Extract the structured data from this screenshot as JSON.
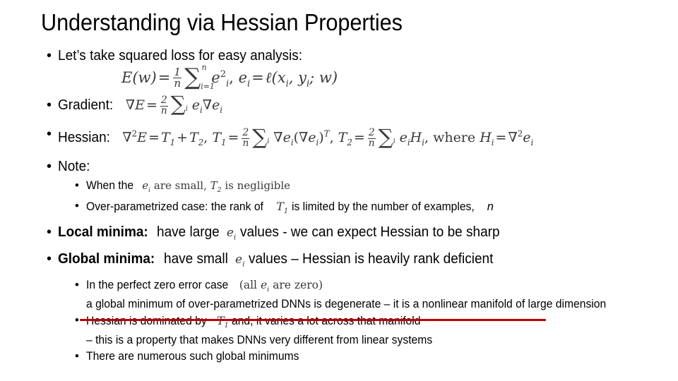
{
  "slide": {
    "title": "Understanding via Hessian Properties",
    "background_color": "#FFFFFF",
    "text_color": "#000000",
    "highlight_color": "#C00000"
  },
  "bullets": {
    "squared_loss_intro": "Let’s take squared loss for easy analysis:",
    "gradient_label": "Gradient:",
    "hessian_label": "Hessian:",
    "note_label": "Note:",
    "note_when_prefix": "When the",
    "over_parametrized_a": "Over-parametrized case: the rank of",
    "over_parametrized_b": "is limited by the number of examples,",
    "over_parametrized_n": "n",
    "local_minima_label": "Local minima:",
    "local_minima_a": "have large",
    "local_minima_b": "values - we can expect Hessian to be sharp",
    "global_minima_label": "Global minima:",
    "global_minima_a": "have small",
    "global_minima_b": "values – Hessian is heavily rank deficient",
    "zero_error_a": "In the perfect zero error case",
    "zero_error_b": "a global minimum of over-parametrized DNNs is degenerate – it is a nonlinear manifold of large dimension",
    "dominated_a": "Hessian is dominated by",
    "dominated_b": "and, it varies a lot across that manifold",
    "dominated_c": "– this is a property that makes DNNs very different from linear systems",
    "numerous_minimums": "There are numerous such global minimums"
  },
  "math": {
    "loss_E": "E",
    "loss_w": "(w)",
    "equals": "=",
    "one": "1",
    "two": "2",
    "n": "n",
    "sum_lower_i1": "i=1",
    "sum_upper_n": "n",
    "sum_lower_i": "i",
    "e": "e",
    "i": "i",
    "sq": "2",
    "comma": ",",
    "ell": "ℓ",
    "loss_args": "(x",
    "loss_args_y": ", y",
    "loss_args_w": "; w)",
    "nabla": "∇",
    "T": "T",
    "T1_sub": "1",
    "T2_sub": "2",
    "plus": "+",
    "H": "H",
    "where": "where",
    "transpose": "T",
    "all_e_are_zero_open": "(all",
    "all_e_are_zero_close": "are zero)",
    "are_small": "are small,",
    "is_negligible": "is negligible"
  },
  "formulas_plaintext": {
    "squared_loss": "E(w) = (1/n) Σ_{i=1}^{n} e_i^2,  e_i = ℓ(x_i, y_i; w)",
    "gradient": "∇E = (2/n) Σ_i e_i ∇e_i",
    "hessian": "∇²E = T₁ + T₂,  T₁ = (2/n) Σ_i ∇e_i(∇e_i)ᵀ,  T₂ = (2/n) Σ_i e_i H_i,  where H_i = ∇²e_i"
  }
}
